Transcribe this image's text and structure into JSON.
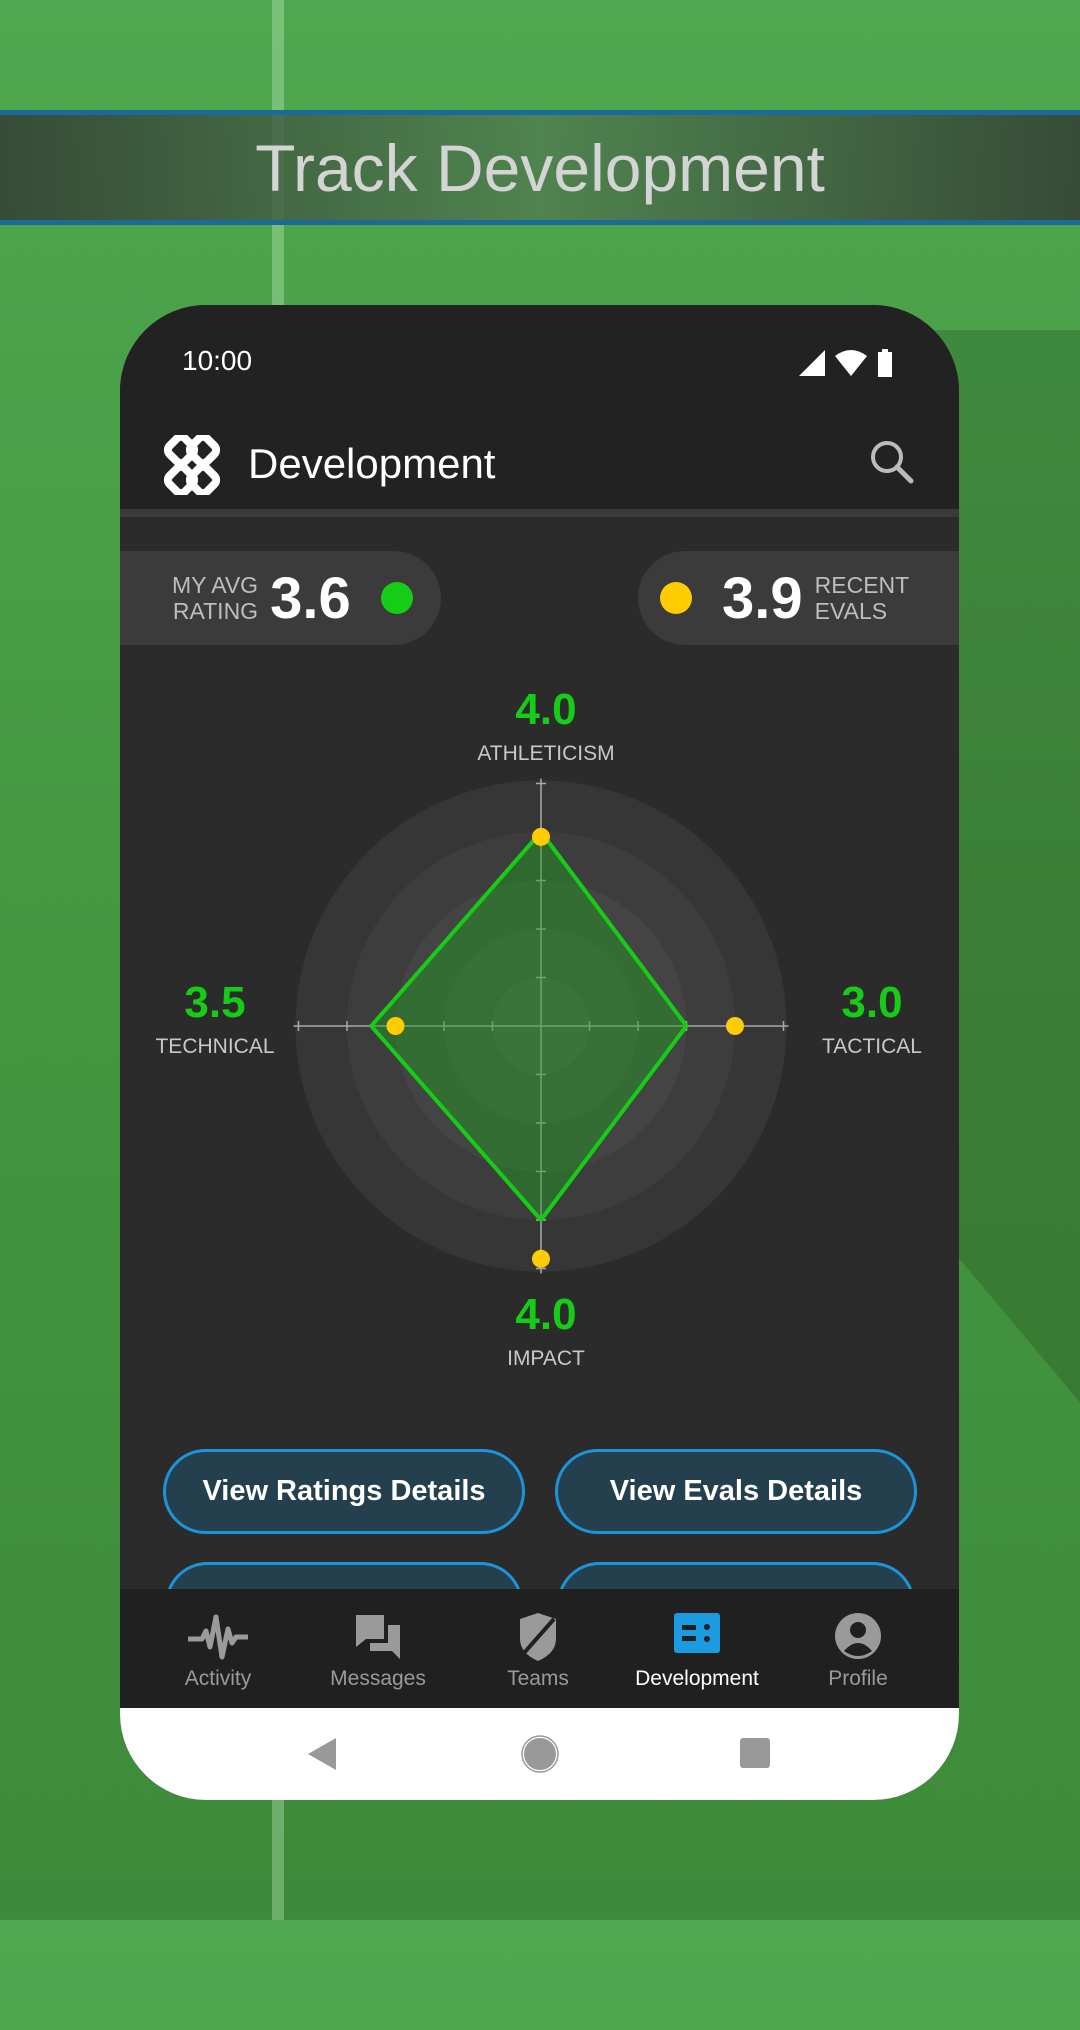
{
  "banner": {
    "title": "Track Development"
  },
  "status_bar": {
    "time": "10:00",
    "icons": [
      "signal-icon",
      "wifi-icon",
      "battery-icon"
    ]
  },
  "app_bar": {
    "title": "Development",
    "logo": "app-logo",
    "search_icon": "search-icon"
  },
  "summary": {
    "my_avg": {
      "label_line1": "MY AVG",
      "label_line2": "RATING",
      "value": "3.6",
      "color": "#16cc16"
    },
    "recent": {
      "label_line1": "RECENT",
      "label_line2": "EVALS",
      "value": "3.9",
      "color": "#ffcc00"
    }
  },
  "chart_data": {
    "type": "radar",
    "axes": [
      "ATHLETICISM",
      "TACTICAL",
      "IMPACT",
      "TECHNICAL"
    ],
    "axis_values": [
      "4.0",
      "3.0",
      "4.0",
      "3.5"
    ],
    "range": [
      0,
      5
    ],
    "ticks": [
      1,
      2,
      3,
      4,
      5
    ],
    "series": [
      {
        "values": [
          4.0,
          3.0,
          4.0,
          3.5
        ],
        "color": "#16cc16",
        "style": "filled-polygon"
      },
      {
        "values": [
          3.9,
          4.0,
          4.8,
          3.0
        ],
        "color": "#ffcc00",
        "style": "points"
      }
    ]
  },
  "buttons": {
    "ratings": "View Ratings Details",
    "evals": "View Evals Details"
  },
  "bottom_nav": {
    "items": [
      {
        "label": "Activity",
        "icon": "activity-icon"
      },
      {
        "label": "Messages",
        "icon": "messages-icon"
      },
      {
        "label": "Teams",
        "icon": "teams-shield-icon"
      },
      {
        "label": "Development",
        "icon": "development-icon",
        "active": true
      },
      {
        "label": "Profile",
        "icon": "profile-icon"
      }
    ],
    "active_color": "#1b9be0"
  },
  "system_nav": {
    "icons": [
      "back-icon",
      "home-icon",
      "recents-icon"
    ]
  }
}
